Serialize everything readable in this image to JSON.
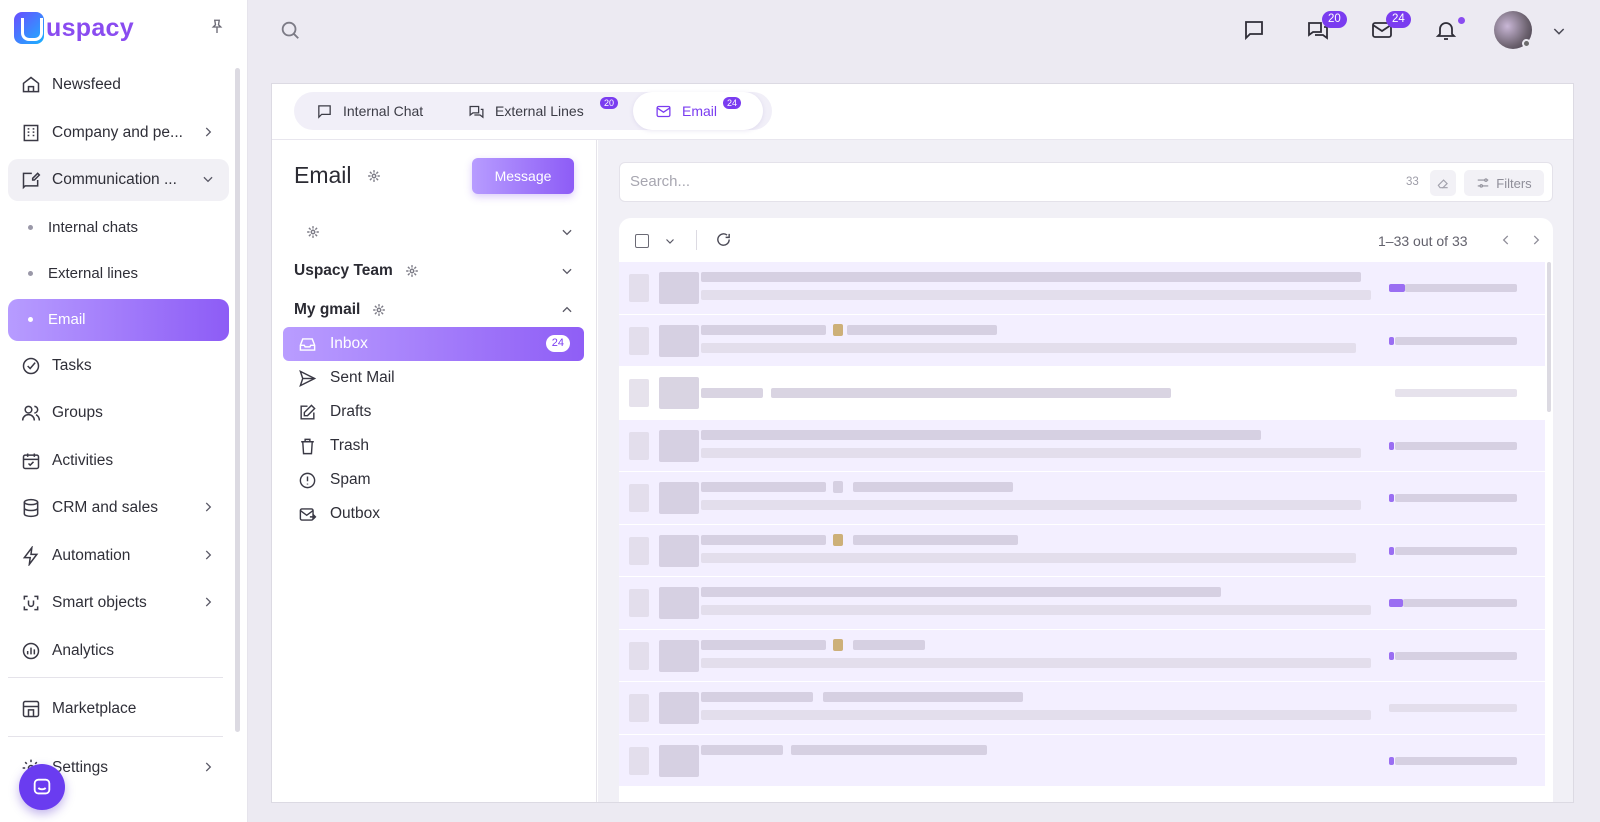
{
  "app": {
    "name": "uspacy"
  },
  "sidebar": {
    "items": [
      {
        "label": "Newsfeed",
        "icon": "home-icon"
      },
      {
        "label": "Company and pe...",
        "icon": "building-icon"
      },
      {
        "label": "Communication ...",
        "icon": "chat-edit-icon"
      },
      {
        "label": "Internal chats"
      },
      {
        "label": "External lines"
      },
      {
        "label": "Email"
      },
      {
        "label": "Tasks",
        "icon": "check-circle-icon"
      },
      {
        "label": "Groups",
        "icon": "users-icon"
      },
      {
        "label": "Activities",
        "icon": "calendar-check-icon"
      },
      {
        "label": "CRM and sales",
        "icon": "database-icon"
      },
      {
        "label": "Automation",
        "icon": "lightning-icon"
      },
      {
        "label": "Smart objects",
        "icon": "scan-icon"
      },
      {
        "label": "Analytics",
        "icon": "chart-circle-icon"
      },
      {
        "label": "Marketplace",
        "icon": "store-icon"
      },
      {
        "label": "Settings",
        "icon": "gear-icon"
      }
    ]
  },
  "topbar": {
    "chat_badge": "20",
    "mail_badge": "24"
  },
  "tabs": [
    {
      "label": "Internal Chat",
      "badge": ""
    },
    {
      "label": "External Lines",
      "badge": "20"
    },
    {
      "label": "Email",
      "badge": "24"
    }
  ],
  "email_panel": {
    "title": "Email",
    "message_button": "Message",
    "accounts": [
      {
        "label": ""
      },
      {
        "label": "Uspacy Team"
      },
      {
        "label": "My gmail"
      }
    ],
    "folders": [
      {
        "label": "Inbox",
        "count": "24"
      },
      {
        "label": "Sent Mail"
      },
      {
        "label": "Drafts"
      },
      {
        "label": "Trash"
      },
      {
        "label": "Spam"
      },
      {
        "label": "Outbox"
      }
    ]
  },
  "list": {
    "search_placeholder": "Search...",
    "search_count": "33",
    "filters_label": "Filters",
    "pager": "1–33 out of 33"
  },
  "colors": {
    "accent": "#7a3cf0",
    "accent_light": "#b79cff",
    "unread_row": "#f3efff"
  }
}
